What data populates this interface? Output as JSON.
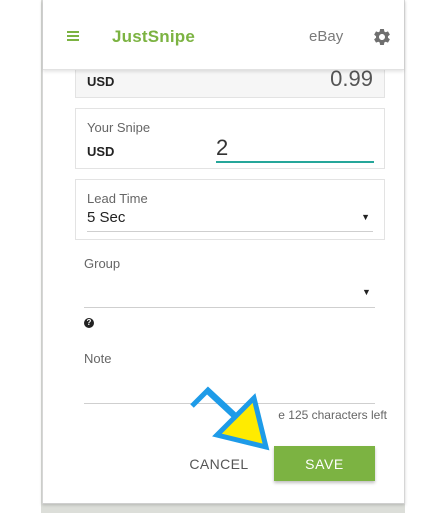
{
  "header": {
    "title": "JustSnipe",
    "site": "eBay",
    "menu_icon": "hamburger-menu-icon",
    "settings_icon": "gear-icon"
  },
  "form": {
    "current_price": {
      "currency": "USD",
      "value": "0.99"
    },
    "snipe": {
      "label": "Your Snipe",
      "currency": "USD",
      "value": "2"
    },
    "lead_time": {
      "label": "Lead Time",
      "selected": "5 Sec"
    },
    "group": {
      "label": "Group",
      "selected": ""
    },
    "note": {
      "label": "Note",
      "chars_left": "e 125 characters left"
    }
  },
  "actions": {
    "cancel_label": "CANCEL",
    "save_label": "SAVE"
  },
  "colors": {
    "brand_green": "#7cb342",
    "input_underline": "#26a69a",
    "arrow_fill": "#ffeb00",
    "arrow_outline": "#1e9be8"
  }
}
